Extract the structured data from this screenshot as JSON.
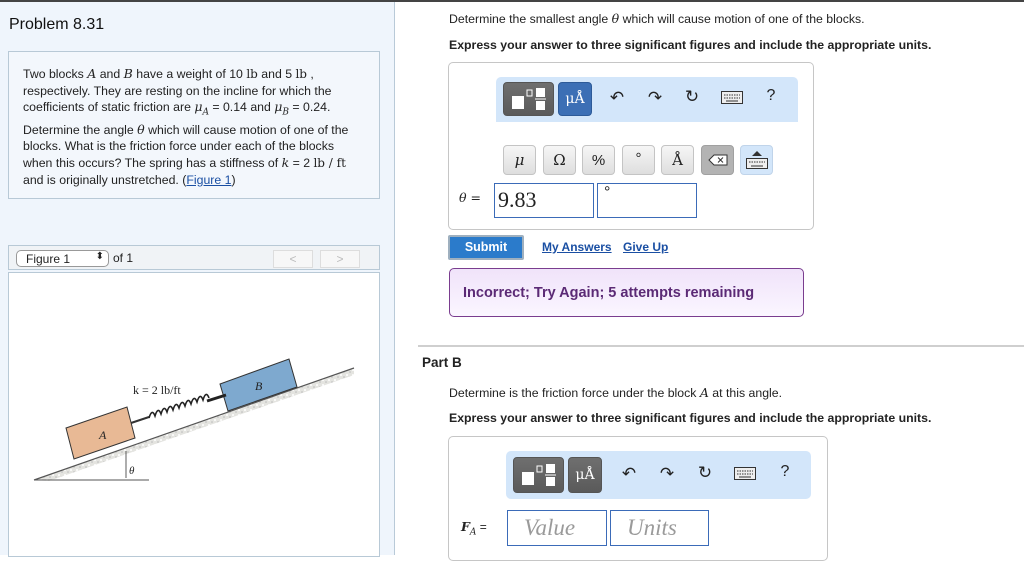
{
  "problem": {
    "title": "Problem 8.31",
    "description": {
      "t1": "Two blocks ",
      "blockA": "A",
      "t2": " and ",
      "blockB": "B",
      "t3": " have a weight of 10 ",
      "unit_lb1": "lb",
      "t4": " and 5 ",
      "unit_lb2": "lb",
      "t5": " , respectively. They are resting on the incline for which the coefficients of static friction are ",
      "muA": "μ",
      "subA": "A",
      "t6": " = 0.14 and ",
      "muB": "μ",
      "subB": "B",
      "t7": " = 0.24. Determine the angle ",
      "theta": "θ",
      "t8": " which will cause motion of one of the blocks. What is the friction force under each of the blocks when this occurs? The spring has a stiffness of ",
      "k": "k",
      "t9": " = 2 ",
      "unit_k": "lb / ft",
      "t10": " and is originally unstretched. (",
      "figure_link": "Figure 1",
      "t11": ")"
    }
  },
  "figure_nav": {
    "selected": "Figure 1",
    "of_label": "of 1",
    "prev": "<",
    "next": ">"
  },
  "figure": {
    "spring_label": "k = 2 lb/ft",
    "block_a_label": "A",
    "block_b_label": "B",
    "angle_label": "θ"
  },
  "part_a": {
    "question_pre": "Determine the smallest angle ",
    "question_theta": "θ",
    "question_post": " which will cause motion of one of the blocks.",
    "instruction": "Express your answer to three significant figures and include the appropriate units.",
    "toolbar": {
      "units_label": "μÅ",
      "help_label": "?"
    },
    "keys": [
      "μ",
      "Ω",
      "%",
      "°",
      "Å"
    ],
    "answer_label": "θ =",
    "value": "9.83",
    "units_value": "°",
    "submit_label": "Submit",
    "my_answers_label": "My Answers",
    "give_up_label": "Give Up",
    "feedback": "Incorrect; Try Again; 5 attempts remaining"
  },
  "part_b": {
    "title": "Part B",
    "question_pre": "Determine is the friction force under the block ",
    "question_var": "A",
    "question_post": " at this angle.",
    "instruction": "Express your answer to three significant figures and include the appropriate units.",
    "toolbar": {
      "units_label": "μÅ",
      "help_label": "?"
    },
    "answer_label_var": "F",
    "answer_label_sub": "A",
    "answer_label_eq": " =",
    "value_placeholder": "Value",
    "units_placeholder": "Units"
  }
}
